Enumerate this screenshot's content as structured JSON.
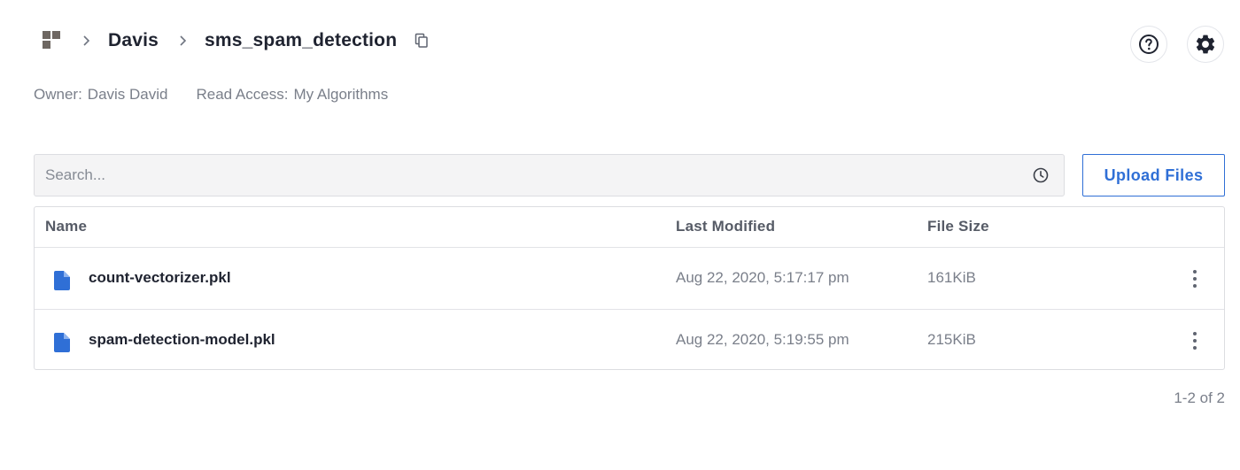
{
  "breadcrumb": {
    "logo_icon": "app-grid-logo-icon",
    "owner": "Davis",
    "collection": "sms_spam_detection",
    "copy_icon": "copy-icon"
  },
  "header_actions": {
    "help_icon": "help-circle-icon",
    "settings_icon": "gear-icon"
  },
  "meta": {
    "owner_label": "Owner:",
    "owner_value": "Davis David",
    "access_label": "Read Access:",
    "access_value": "My Algorithms"
  },
  "search": {
    "placeholder": "Search...",
    "value": "",
    "icon": "clock-icon"
  },
  "upload_button": {
    "label": "Upload Files",
    "color": "#2f6fd6"
  },
  "table": {
    "columns": [
      "Name",
      "Last Modified",
      "File Size"
    ],
    "rows": [
      {
        "icon": "file-icon",
        "name": "count-vectorizer.pkl",
        "modified": "Aug 22, 2020, 5:17:17 pm",
        "size": "161KiB",
        "menu_icon": "more-vertical-icon"
      },
      {
        "icon": "file-icon",
        "name": "spam-detection-model.pkl",
        "modified": "Aug 22, 2020, 5:19:55 pm",
        "size": "215KiB",
        "menu_icon": "more-vertical-icon"
      }
    ]
  },
  "pagination": {
    "text": "1-2 of 2"
  },
  "colors": {
    "accent": "#2f6fd6",
    "file_icon": "#2f6fd6",
    "logo": "#6e6762"
  }
}
